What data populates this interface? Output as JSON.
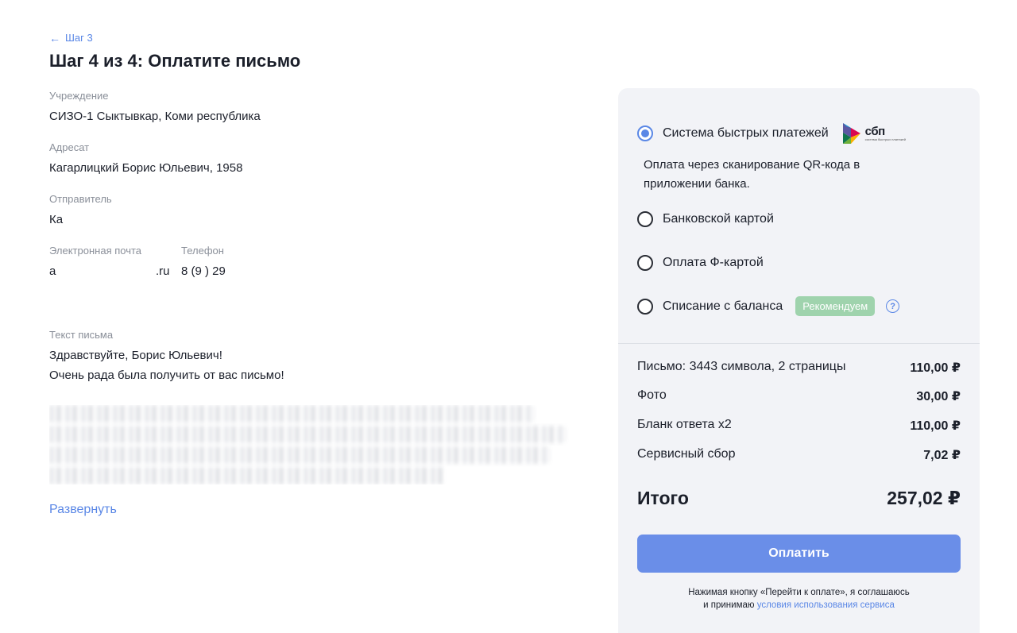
{
  "nav": {
    "back_label": "Шаг 3"
  },
  "page": {
    "title": "Шаг 4 из 4: Оплатите письмо"
  },
  "details": {
    "institution_label": "Учреждение",
    "institution_value": "СИЗО-1 Сыктывкар, Коми республика",
    "recipient_label": "Адресат",
    "recipient_value": "Кагарлицкий Борис Юльевич, 1958",
    "sender_label": "Отправитель",
    "sender_value": "Ка",
    "email_label": "Электронная почта",
    "email_value_start": "a",
    "email_value_end": ".ru",
    "phone_label": "Телефон",
    "phone_value": "8 (9  ) 29"
  },
  "letter": {
    "label": "Текст письма",
    "line1": "Здравствуйте, Борис Юльевич!",
    "line2": "Очень рада была получить от вас письмо!",
    "expand_label": "Развернуть"
  },
  "payment": {
    "methods": [
      {
        "label": "Система быстрых платежей",
        "checked": true
      },
      {
        "label": "Банковской картой",
        "checked": false
      },
      {
        "label": "Оплата Ф-картой",
        "checked": false
      },
      {
        "label": "Списание с баланса",
        "checked": false
      }
    ],
    "sbp_logo_text": "сбп",
    "sbp_logo_sub": "система быстрых платежей",
    "sbp_description": "Оплата через сканирование QR-кода в приложении банка.",
    "recommend_badge": "Рекомендуем",
    "help_icon": "?"
  },
  "summary": {
    "items": [
      {
        "label": "Письмо: 3443 символа, 2 страницы",
        "amount": "110,00 ₽"
      },
      {
        "label": "Фото",
        "amount": "30,00 ₽"
      },
      {
        "label": "Бланк ответа x2",
        "amount": "110,00 ₽"
      },
      {
        "label": "Сервисный сбор",
        "amount": "7,02 ₽"
      }
    ],
    "total_label": "Итого",
    "total_amount": "257,02 ₽",
    "pay_button": "Оплатить",
    "agreement_text": "Нажимая кнопку «Перейти к оплате», я соглашаюсь",
    "agreement_text2": "и принимаю",
    "agreement_link": "условия использования сервиса"
  },
  "colors": {
    "accent": "#5a87e6",
    "button": "#6a8ee8",
    "panel_bg": "#f2f3f7",
    "badge_bg": "#9fd3ad"
  }
}
